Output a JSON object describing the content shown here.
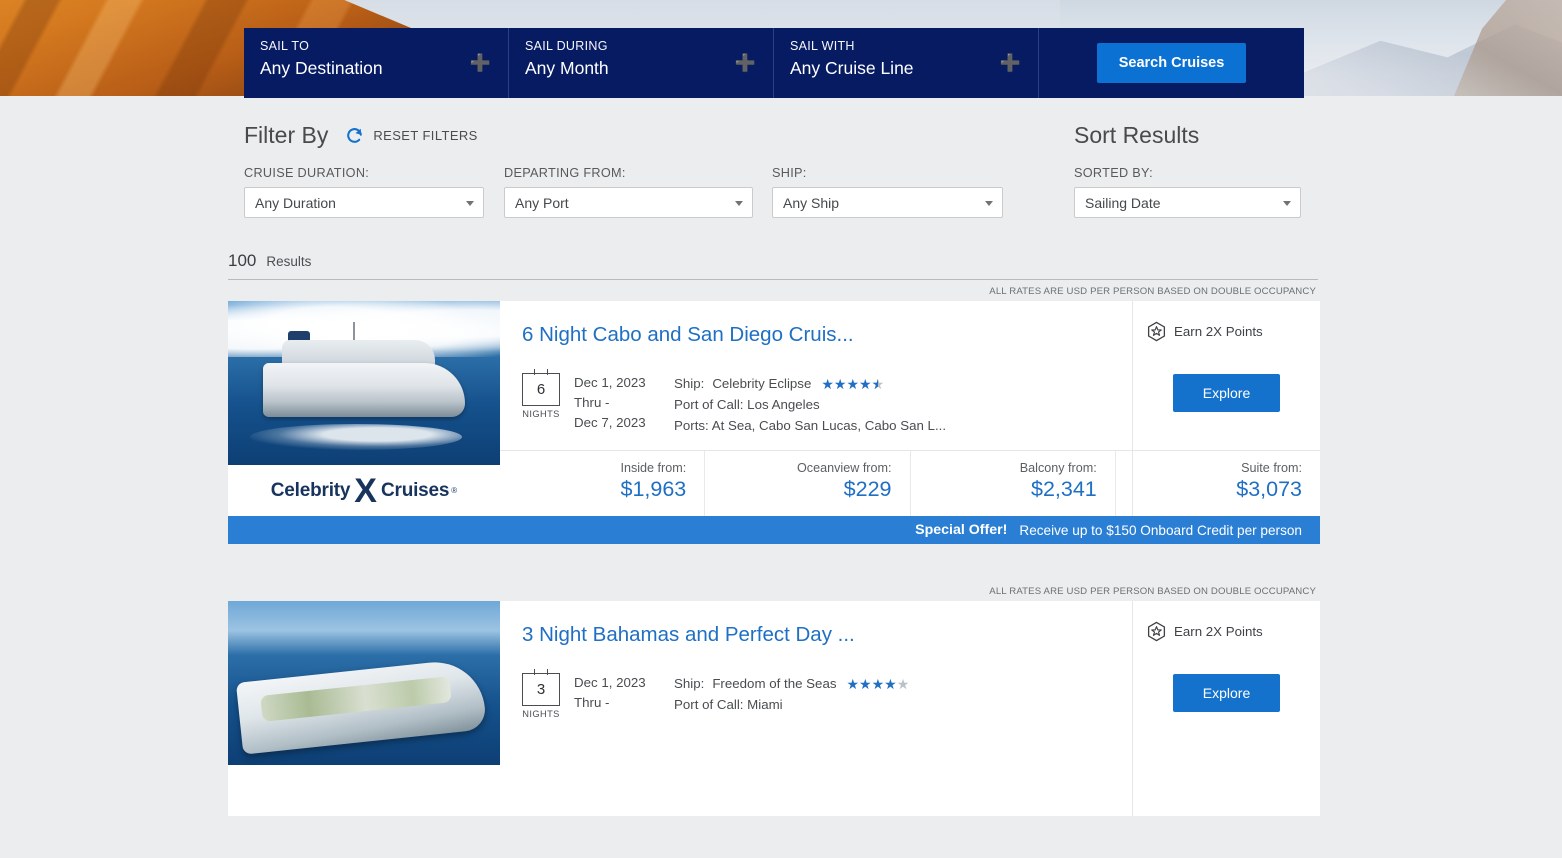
{
  "search_bar": {
    "fields": [
      {
        "label": "SAIL TO",
        "value": "Any Destination",
        "icon": "plus-icon"
      },
      {
        "label": "SAIL DURING",
        "value": "Any Month",
        "icon": "plus-icon"
      },
      {
        "label": "SAIL WITH",
        "value": "Any Cruise Line",
        "icon": "plus-icon"
      }
    ],
    "submit_label": "Search Cruises",
    "bar_color": "#071b63",
    "button_color": "#0b72d4"
  },
  "filters": {
    "title": "Filter By",
    "reset_label": "RESET FILTERS",
    "reset_icon": "refresh-icon",
    "fields": [
      {
        "label": "CRUISE DURATION:",
        "value": "Any Duration"
      },
      {
        "label": "DEPARTING FROM:",
        "value": "Any Port"
      },
      {
        "label": "SHIP:",
        "value": "Any Ship"
      }
    ]
  },
  "sort": {
    "title": "Sort Results",
    "label": "SORTED BY:",
    "value": "Sailing Date"
  },
  "results": {
    "count": "100",
    "word": "Results",
    "rates_note": "ALL RATES ARE USD PER PERSON BASED ON DOUBLE OCCUPANCY"
  },
  "cards": [
    {
      "title": "6 Night Cabo and San Diego Cruis...",
      "nights": "6",
      "nights_label": "NIGHTS",
      "date_start": "Dec 1, 2023",
      "date_thru": "Thru -",
      "date_end": "Dec 7, 2023",
      "ship_label": "Ship:",
      "ship_name": "Celebrity Eclipse",
      "rating": 4.5,
      "port_label": "Port of Call:",
      "port_value": "Los Angeles",
      "ports_label": "Ports:",
      "ports_value": "At Sea, Cabo San Lucas, Cabo San L...",
      "points_label": "Earn 2X Points",
      "points_icon": "hexagon-star-icon",
      "explore_label": "Explore",
      "brand": {
        "word1": "Celebrity",
        "mark": "X",
        "word2": "Cruises",
        "reg": "®"
      },
      "prices": [
        {
          "label": "Inside from:",
          "value": "$1,963"
        },
        {
          "label": "Oceanview from:",
          "value": "$229"
        },
        {
          "label": "Balcony from:",
          "value": "$2,341"
        },
        {
          "label": "Suite from:",
          "value": "$3,073"
        }
      ],
      "offer_strong": "Special Offer!",
      "offer_text": "Receive up to $150 Onboard Credit per person"
    },
    {
      "title": "3 Night Bahamas and Perfect Day ...",
      "nights": "3",
      "nights_label": "NIGHTS",
      "date_start": "Dec 1, 2023",
      "date_thru": "Thru -",
      "date_end": "",
      "ship_label": "Ship:",
      "ship_name": "Freedom of the Seas",
      "rating": 4,
      "port_label": "Port of Call:",
      "port_value": "Miami",
      "ports_label": "",
      "ports_value": "",
      "points_label": "Earn 2X Points",
      "points_icon": "hexagon-star-icon",
      "explore_label": "Explore",
      "prices": [],
      "offer_strong": "",
      "offer_text": ""
    }
  ]
}
